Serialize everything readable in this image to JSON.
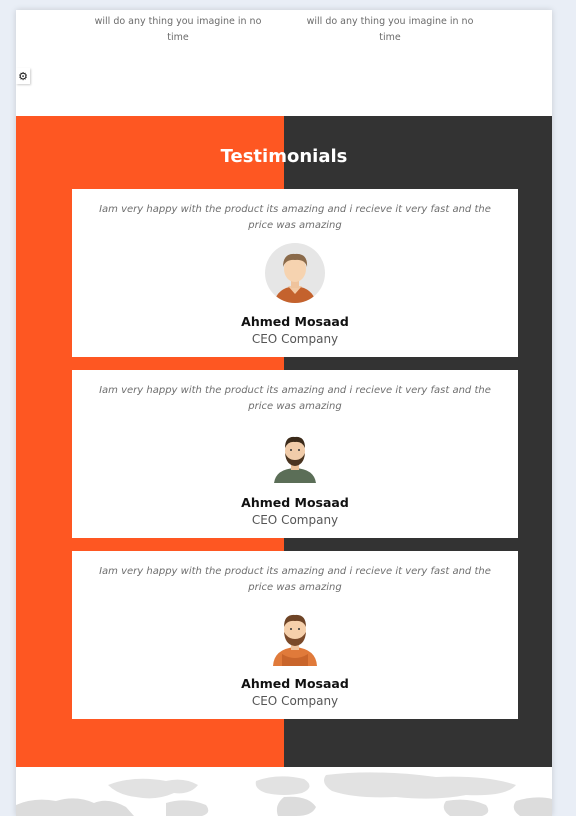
{
  "services": {
    "items": [
      {
        "text": "will do any thing you imagine in no time"
      },
      {
        "text": "will do any thing you imagine in no time"
      }
    ]
  },
  "settings": {
    "icon": "gear-icon"
  },
  "testimonials": {
    "title": "Testimonials",
    "colors": {
      "left": "#fe5722",
      "right": "#333333"
    },
    "items": [
      {
        "quote": "Iam very happy with the product its amazing and i recieve it very fast and the price was amazing",
        "name": "Ahmed Mosaad",
        "role": "CEO Company",
        "avatar": "man-avatar-icon"
      },
      {
        "quote": "Iam very happy with the product its amazing and i recieve it very fast and the price was amazing",
        "name": "Ahmed Mosaad",
        "role": "CEO Company",
        "avatar": "bearded-man-avatar-icon"
      },
      {
        "quote": "Iam very happy with the product its amazing and i recieve it very fast and the price was amazing",
        "name": "Ahmed Mosaad",
        "role": "CEO Company",
        "avatar": "bearded-hoodie-avatar-icon"
      }
    ]
  }
}
